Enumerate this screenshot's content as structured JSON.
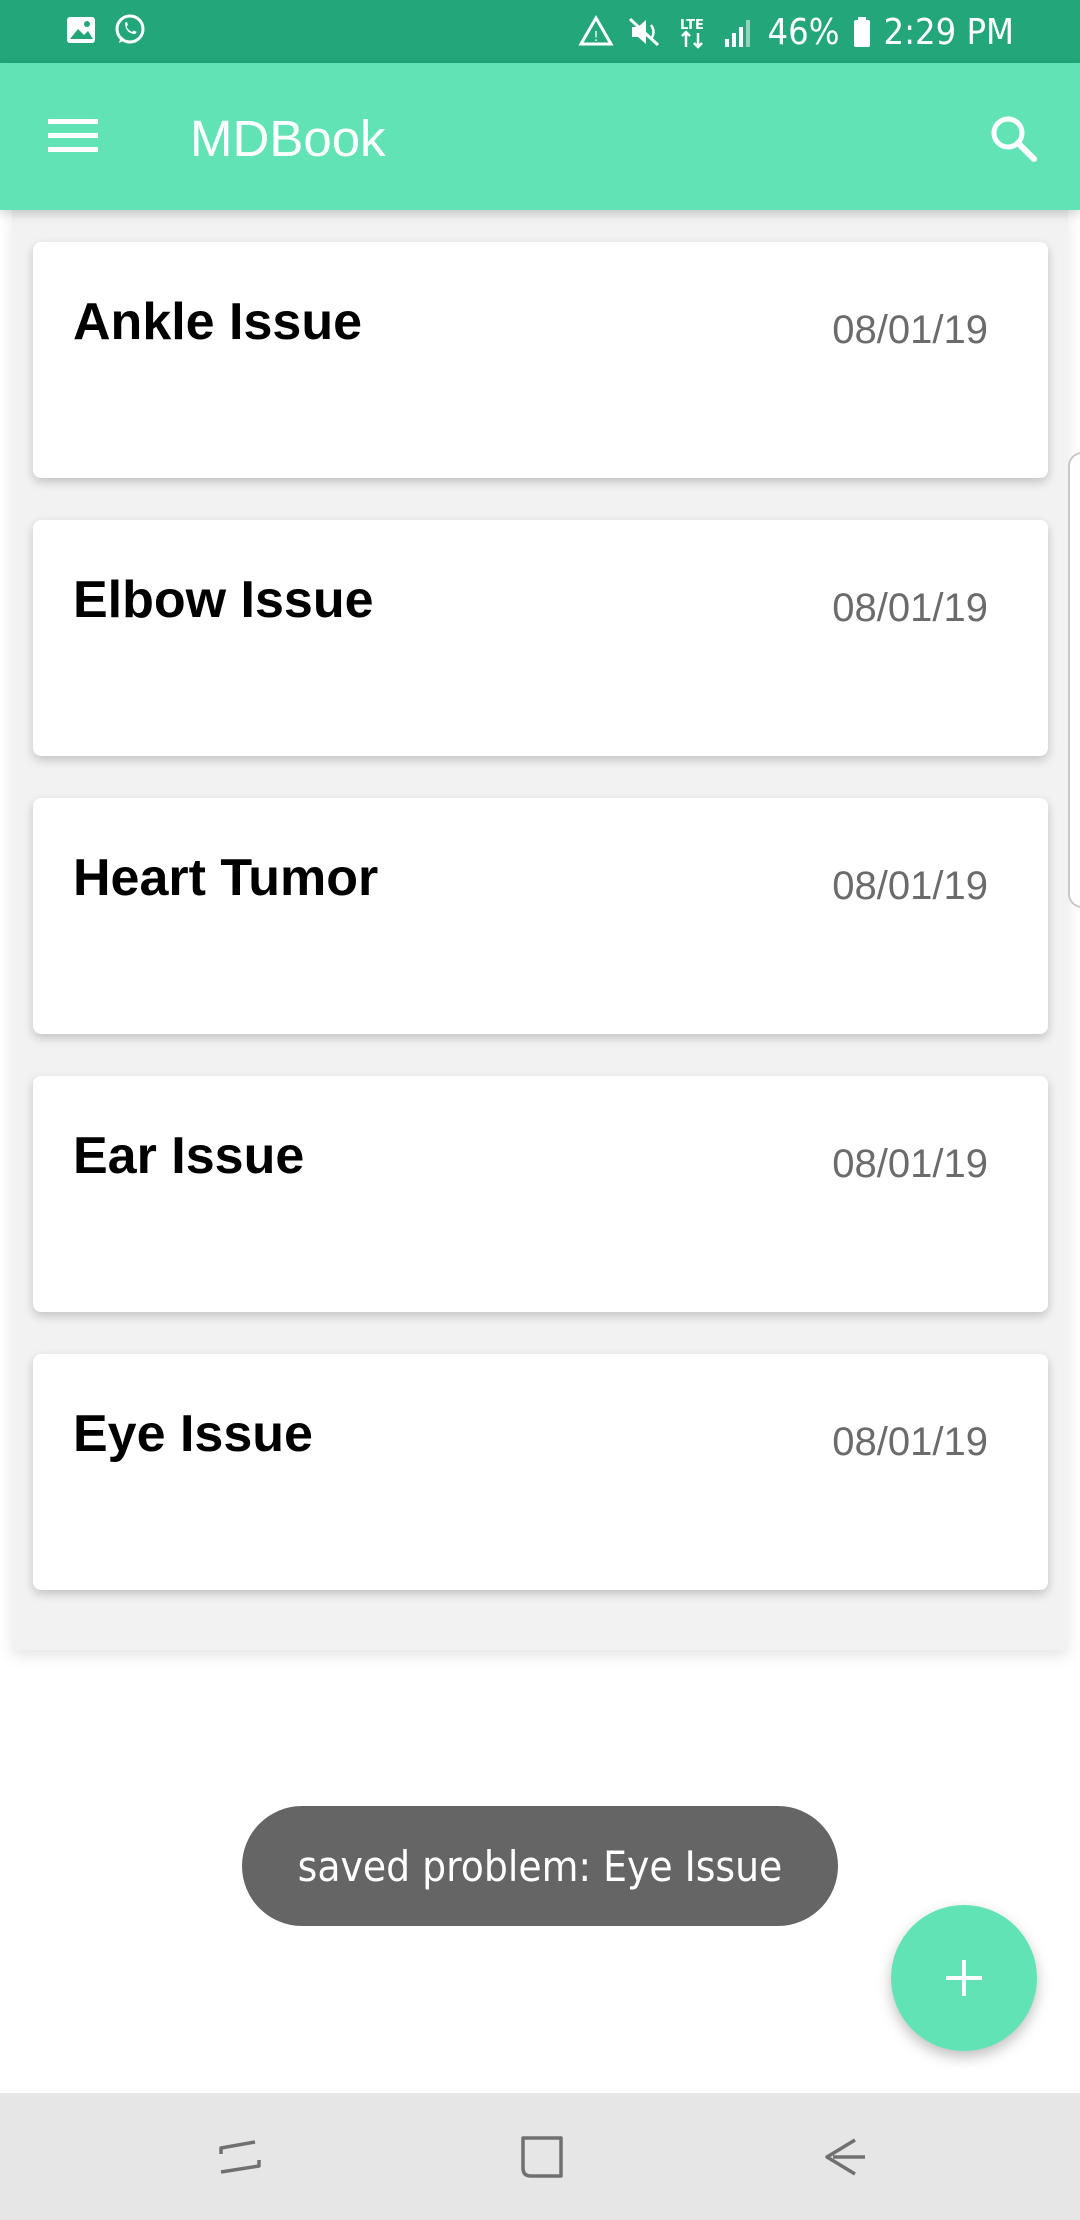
{
  "status_bar": {
    "battery": "46%",
    "time": "2:29 PM",
    "network": "LTE",
    "icons": [
      "gallery-icon",
      "whatsapp-icon",
      "data-saver-icon",
      "mute-icon",
      "lte-icon",
      "signal-icon",
      "battery-icon"
    ]
  },
  "app_bar": {
    "title": "MDBook",
    "menu_icon": "hamburger-menu-icon",
    "search_icon": "search-icon"
  },
  "problems": [
    {
      "title": "Ankle Issue",
      "date": "08/01/19"
    },
    {
      "title": "Elbow Issue",
      "date": "08/01/19"
    },
    {
      "title": "Heart Tumor",
      "date": "08/01/19"
    },
    {
      "title": "Ear Issue",
      "date": "08/01/19"
    },
    {
      "title": "Eye Issue",
      "date": "08/01/19"
    }
  ],
  "toast": {
    "text": "saved problem: Eye Issue"
  },
  "fab": {
    "icon": "plus-icon"
  },
  "nav_bar": {
    "icons": [
      "recent-apps-icon",
      "home-icon",
      "back-icon"
    ]
  },
  "colors": {
    "status_bar": "#22a67a",
    "accent": "#62e3b5",
    "toast_bg": "#656565",
    "date_text": "#6b6b6b",
    "nav_bar": "#e6e6e6"
  }
}
